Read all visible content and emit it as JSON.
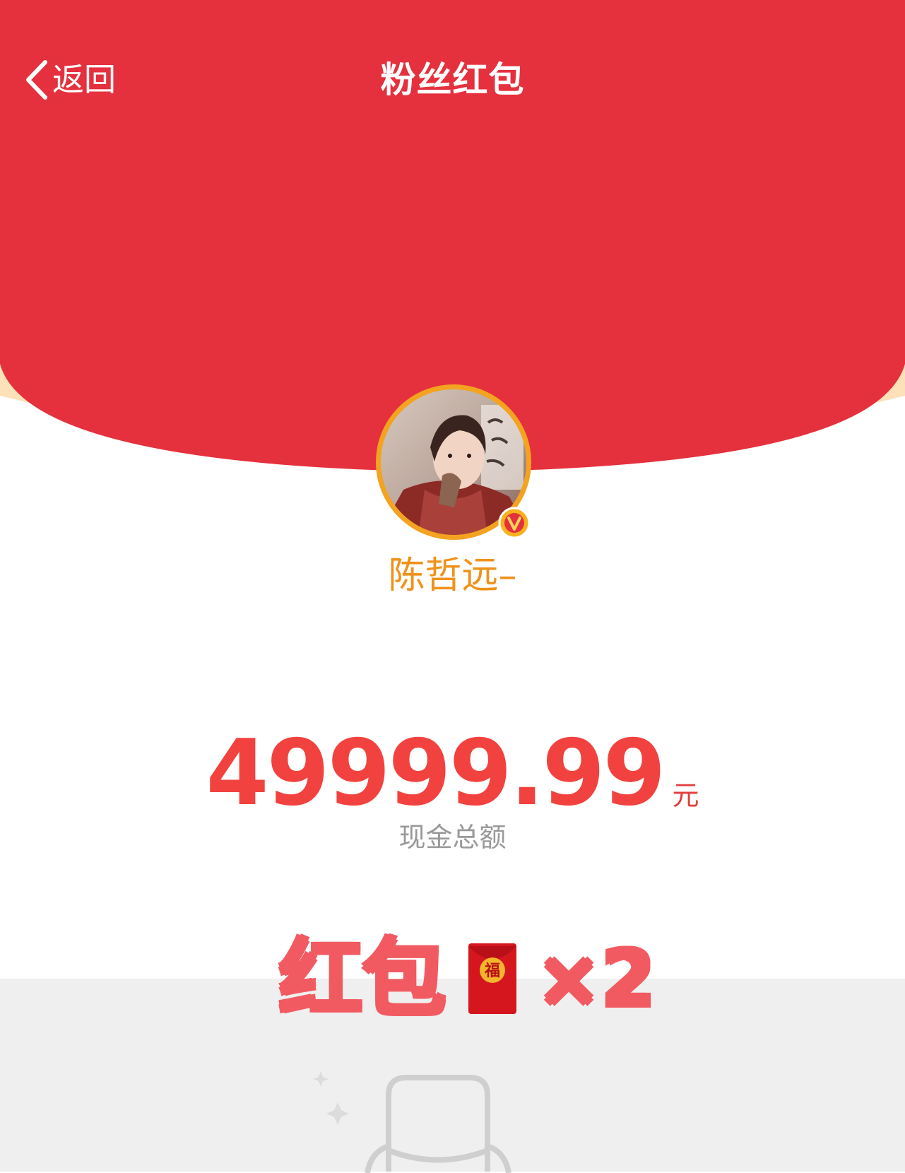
{
  "nav": {
    "back_label": "返回",
    "title": "粉丝红包"
  },
  "profile": {
    "name": "陈哲远–",
    "verified": true
  },
  "amount": {
    "value": "49999.99",
    "unit": "元",
    "caption": "现金总额"
  },
  "sticker": {
    "text": "红包",
    "multiplier": "×2",
    "envelope_char": "福"
  },
  "colors": {
    "header_red": "#e5303d",
    "accent_orange": "#f0921a",
    "amount_red": "#f2423f",
    "caption_gray": "#999999",
    "page_gray": "#efefef"
  },
  "icons": {
    "back": "chevron-left-icon",
    "verified": "verified-badge-icon",
    "envelope": "red-envelope-icon",
    "empty": "empty-bag-icon"
  }
}
